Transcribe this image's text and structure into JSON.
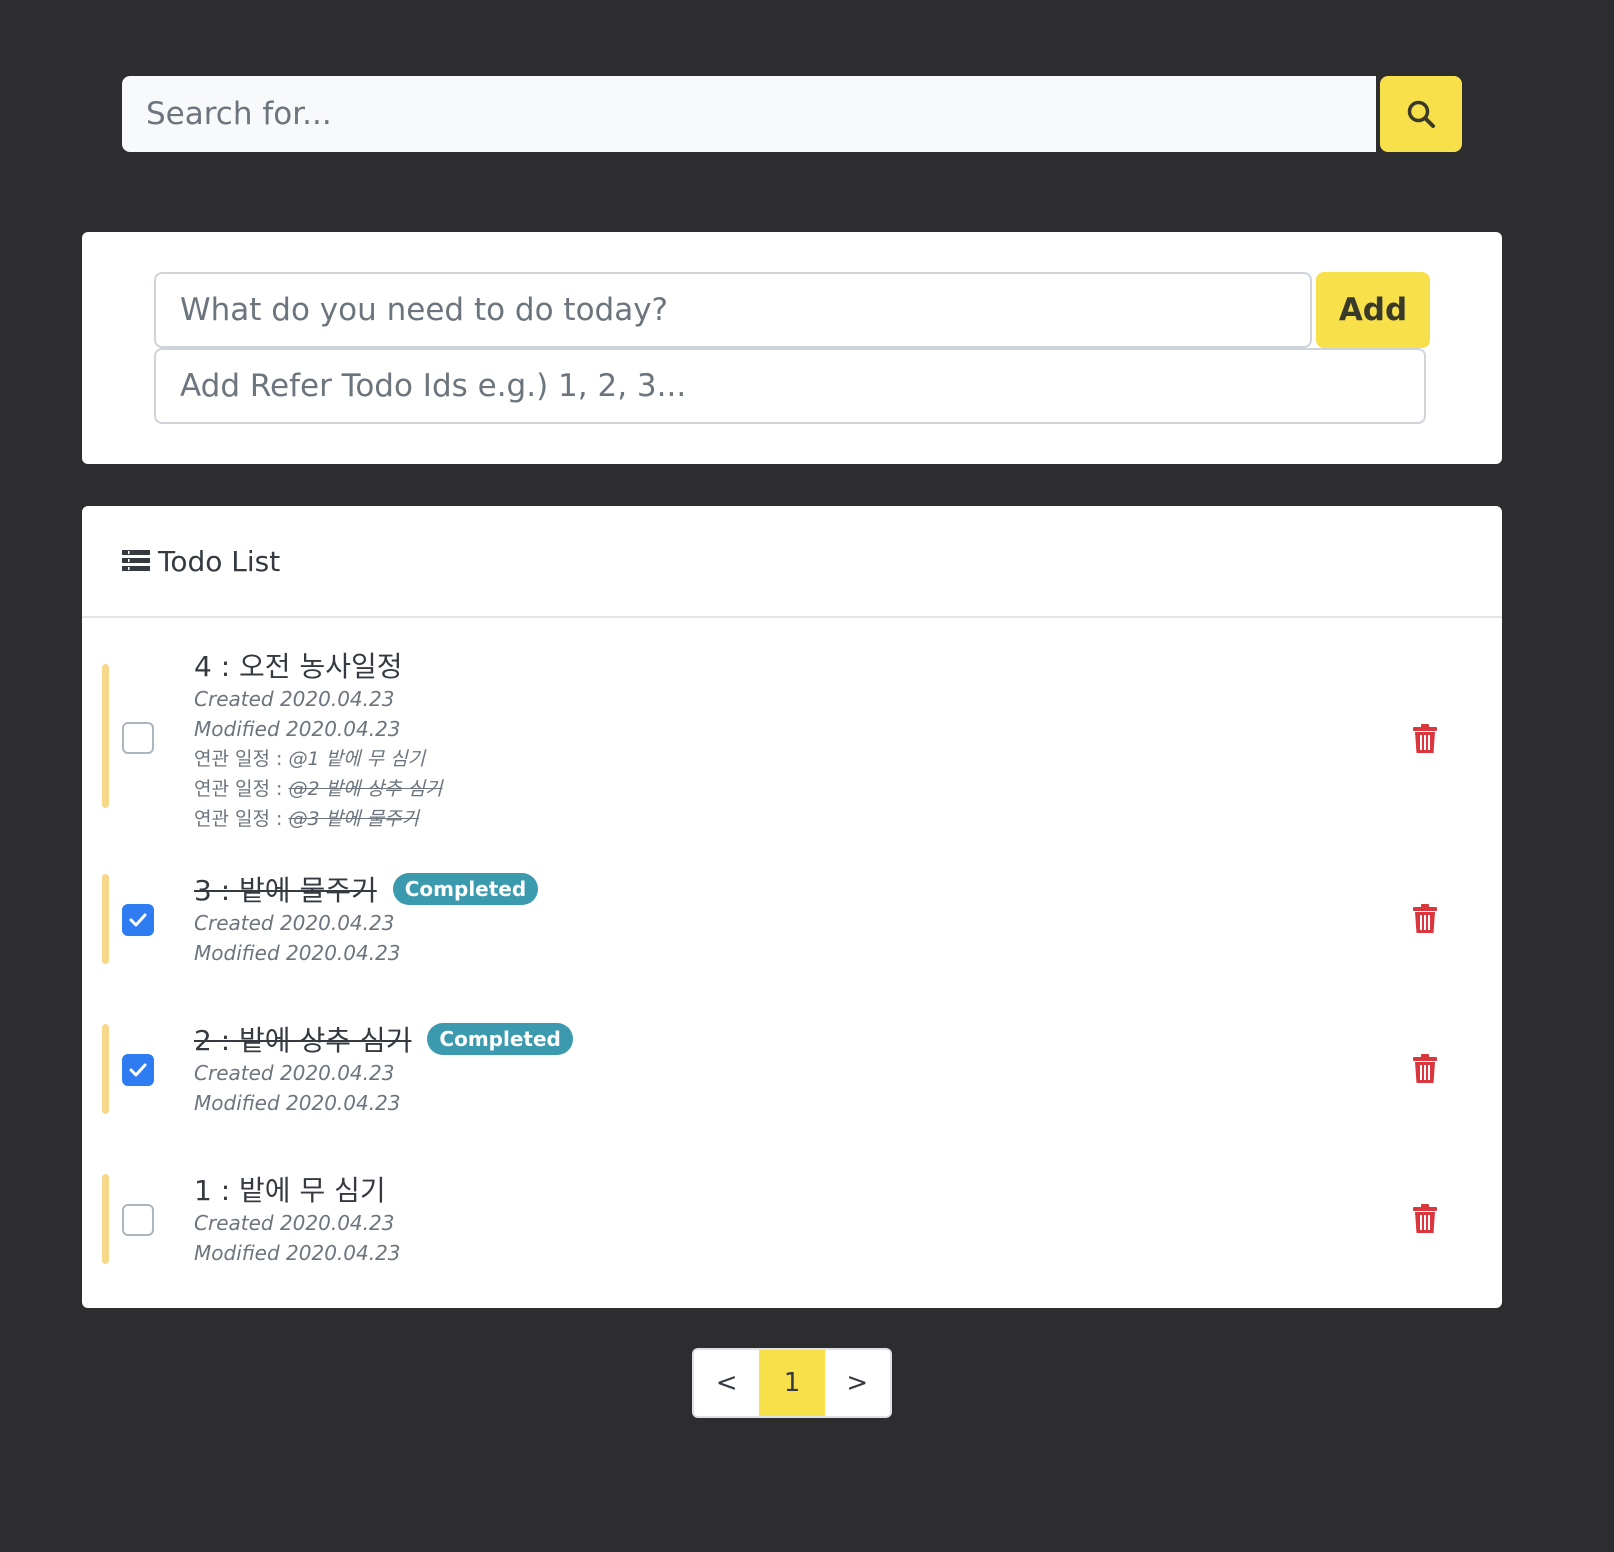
{
  "search": {
    "placeholder": "Search for..."
  },
  "add_form": {
    "todo_placeholder": "What do you need to do today?",
    "add_label": "Add",
    "refer_placeholder": "Add Refer Todo Ids e.g.) 1, 2, 3..."
  },
  "list": {
    "title": "Todo List",
    "items": [
      {
        "title": "4 : 오전 농사일정",
        "completed": false,
        "created": "Created 2020.04.23",
        "modified": "Modified 2020.04.23",
        "refers": [
          {
            "label": "연관 일정 : ",
            "link": "@1 밭에 무 심기",
            "done": false
          },
          {
            "label": "연관 일정 : ",
            "link": "@2 밭에 상추 심기",
            "done": true
          },
          {
            "label": "연관 일정 : ",
            "link": "@3 밭에 물주기",
            "done": true
          }
        ]
      },
      {
        "title": "3 : 밭에 물주기",
        "completed": true,
        "badge": "Completed",
        "created": "Created 2020.04.23",
        "modified": "Modified 2020.04.23"
      },
      {
        "title": "2 : 밭에 상추 심기",
        "completed": true,
        "badge": "Completed",
        "created": "Created 2020.04.23",
        "modified": "Modified 2020.04.23"
      },
      {
        "title": "1 : 밭에 무 심기",
        "completed": false,
        "created": "Created 2020.04.23",
        "modified": "Modified 2020.04.23"
      }
    ]
  },
  "pagination": {
    "prev": "<",
    "current": "1",
    "next": ">"
  },
  "colors": {
    "background": "#2d2d2f",
    "accent": "#f7e04a",
    "checkbox_checked": "#2f7bf1",
    "badge": "#3b9aae",
    "trash": "#d9363e"
  }
}
